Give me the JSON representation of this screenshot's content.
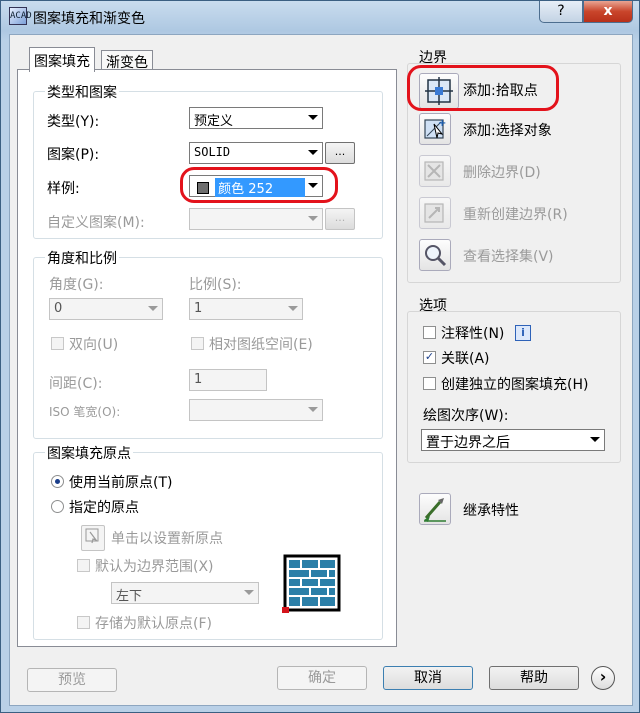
{
  "window": {
    "title": "图案填充和渐变色",
    "app_icon": "ACAD",
    "help_label": "?",
    "close_label": "x"
  },
  "tabs": [
    "图案填充",
    "渐变色"
  ],
  "type_group": {
    "title": "类型和图案",
    "type_label": "类型(Y):",
    "type_value": "预定义",
    "pattern_label": "图案(P):",
    "pattern_value": "SOLID",
    "swatch_label": "样例:",
    "swatch_value": "颜色 252",
    "custom_label": "自定义图案(M):",
    "ellipsis": "..."
  },
  "angle_group": {
    "title": "角度和比例",
    "angle_label": "角度(G):",
    "angle_value": "0",
    "scale_label": "比例(S):",
    "scale_value": "1",
    "double_label": "双向(U)",
    "relative_label": "相对图纸空间(E)",
    "spacing_label": "间距(C):",
    "spacing_value": "1",
    "iso_label": "ISO 笔宽(O):"
  },
  "origin_group": {
    "title": "图案填充原点",
    "current_label": "使用当前原点(T)",
    "specified_label": "指定的原点",
    "click_label": "单击以设置新原点",
    "default_extent_label": "默认为边界范围(X)",
    "position_value": "左下",
    "store_label": "存储为默认原点(F)"
  },
  "boundary": {
    "title": "边界",
    "add_pick": "添加:拾取点",
    "add_select": "添加:选择对象",
    "remove": "删除边界(D)",
    "recreate": "重新创建边界(R)",
    "view": "查看选择集(V)"
  },
  "options": {
    "title": "选项",
    "annotative": "注释性(N)",
    "associative": "关联(A)",
    "separate": "创建独立的图案填充(H)",
    "draw_order_label": "绘图次序(W):",
    "draw_order_value": "置于边界之后",
    "info": "i"
  },
  "inherit_label": "继承特性",
  "footer": {
    "preview": "预览",
    "ok": "确定",
    "cancel": "取消",
    "help": "帮助",
    "more": "›"
  },
  "colors": {
    "highlight": "#e3121b",
    "selection": "#3399ff",
    "swatch": "#6e6e6e",
    "hatch_blue": "#2b7fa8"
  }
}
